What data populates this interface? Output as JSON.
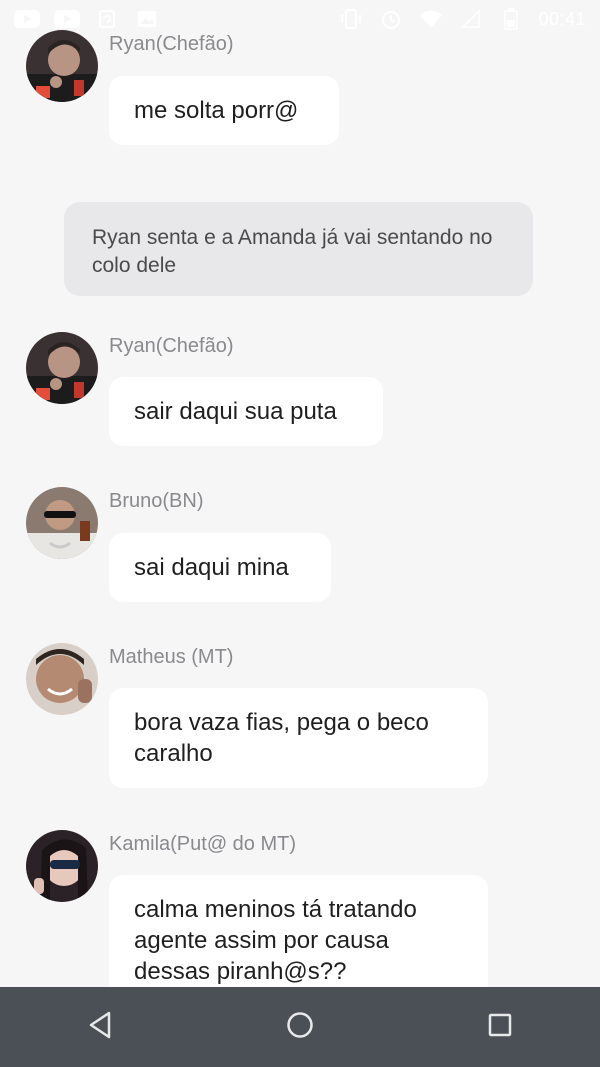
{
  "status_bar": {
    "time": "00:41",
    "left_icons": [
      "youtube-icon",
      "youtube-icon",
      "sync-icon",
      "gallery-icon"
    ],
    "right_icons": [
      "vibrate-icon",
      "alarm-icon",
      "wifi-icon",
      "signal-icon",
      "battery-icon"
    ]
  },
  "messages": [
    {
      "type": "character",
      "name": "Ryan(Chefão)",
      "text": "me solta porr@",
      "avatar": "ryan-avatar"
    },
    {
      "type": "narration",
      "text": "Ryan senta e a Amanda já vai sentando no colo dele"
    },
    {
      "type": "character",
      "name": "Ryan(Chefão)",
      "text": "sair daqui sua puta",
      "avatar": "ryan-avatar"
    },
    {
      "type": "character",
      "name": "Bruno(BN)",
      "text": "sai daqui mina",
      "avatar": "bruno-avatar"
    },
    {
      "type": "character",
      "name": "Matheus (MT)",
      "lines": [
        "bora vaza fias, pega o beco",
        "caralho"
      ],
      "avatar": "matheus-avatar"
    },
    {
      "type": "character",
      "name": "Kamila(Put@ do MT)",
      "lines": [
        "calma meninos tá tratando",
        "agente assim por causa",
        "dessas piranh@s??"
      ],
      "avatar": "kamila-avatar"
    }
  ],
  "nav_bar": {
    "buttons": [
      "back-icon",
      "home-icon",
      "recents-icon"
    ]
  },
  "colors": {
    "background": "#f6f6f7",
    "bubble": "#ffffff",
    "narration": "#e8e8ea",
    "name": "#8a8a8e",
    "nav_bar": "#4a5056"
  }
}
